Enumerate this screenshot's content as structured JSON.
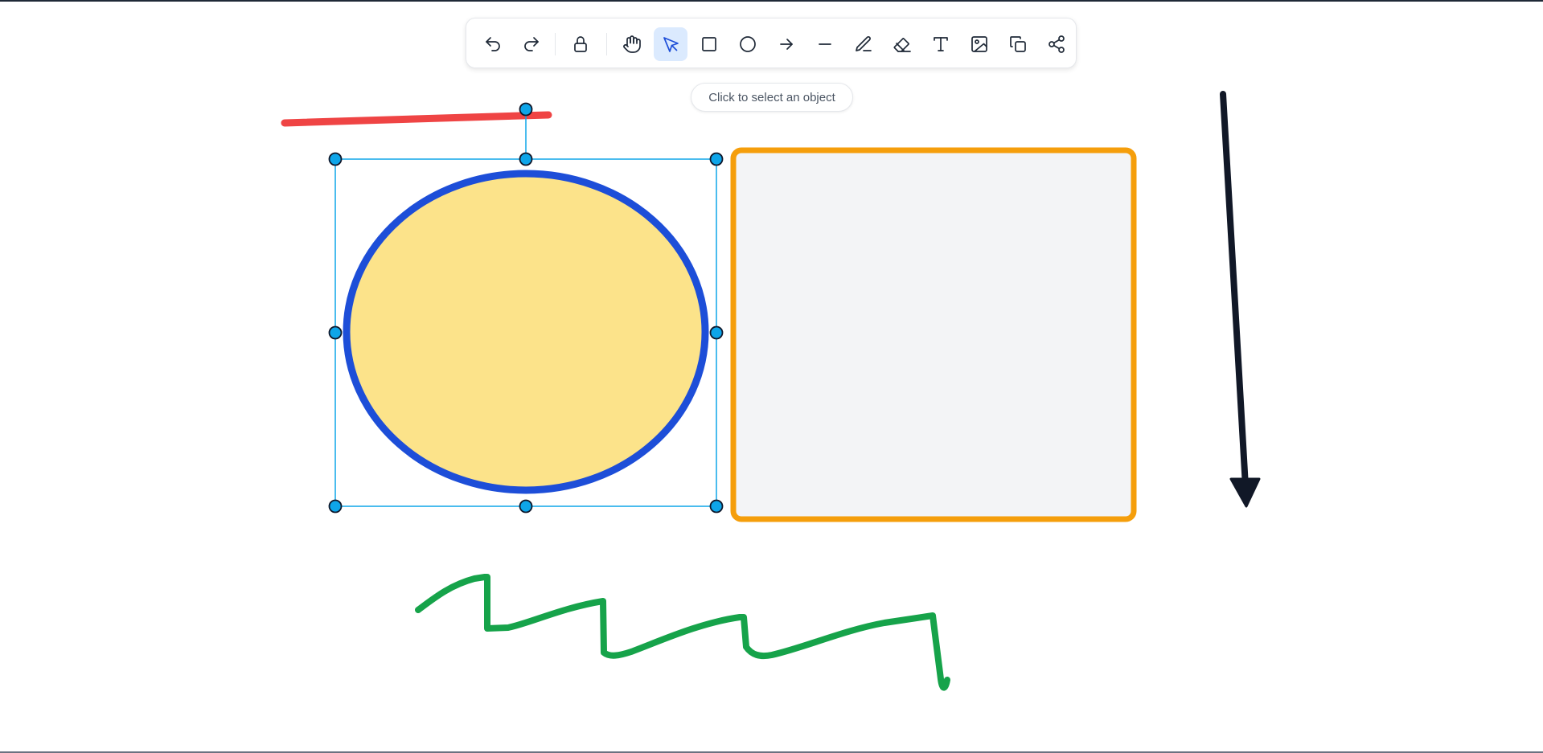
{
  "toolbar": {
    "tools": [
      {
        "id": "undo",
        "label": "Undo",
        "icon": "undo-icon"
      },
      {
        "id": "redo",
        "label": "Redo",
        "icon": "redo-icon"
      },
      {
        "id": "lock",
        "label": "Lock",
        "icon": "lock-icon"
      },
      {
        "id": "hand",
        "label": "Hand",
        "icon": "hand-icon"
      },
      {
        "id": "select",
        "label": "Select",
        "icon": "cursor-icon",
        "active": true
      },
      {
        "id": "rectangle",
        "label": "Rectangle",
        "icon": "rectangle-icon"
      },
      {
        "id": "ellipse",
        "label": "Ellipse",
        "icon": "circle-icon"
      },
      {
        "id": "arrow",
        "label": "Arrow",
        "icon": "arrow-icon"
      },
      {
        "id": "line",
        "label": "Line",
        "icon": "line-icon"
      },
      {
        "id": "pencil",
        "label": "Pencil",
        "icon": "pencil-icon"
      },
      {
        "id": "eraser",
        "label": "Eraser",
        "icon": "eraser-icon"
      },
      {
        "id": "text",
        "label": "Text",
        "icon": "text-icon"
      },
      {
        "id": "image",
        "label": "Image",
        "icon": "image-icon"
      },
      {
        "id": "duplicate",
        "label": "Duplicate",
        "icon": "copy-icon"
      },
      {
        "id": "share",
        "label": "Share",
        "icon": "share-icon"
      }
    ]
  },
  "hint": {
    "text": "Click to select an object"
  },
  "canvas": {
    "shapes": [
      {
        "type": "ellipse",
        "stroke": "#1d4ed8",
        "fill": "#fce38a",
        "selected": true
      },
      {
        "type": "rectangle",
        "stroke": "#f59e0b",
        "fill": "#f3f4f6"
      },
      {
        "type": "line",
        "stroke": "#ef4444"
      },
      {
        "type": "arrow",
        "stroke": "#111827"
      },
      {
        "type": "freehand",
        "stroke": "#16a34a"
      }
    ],
    "selection_color": "#0ea5e9"
  },
  "colors": {
    "accent": "#1d4ed8",
    "active_tool_bg": "#dbeafe"
  }
}
